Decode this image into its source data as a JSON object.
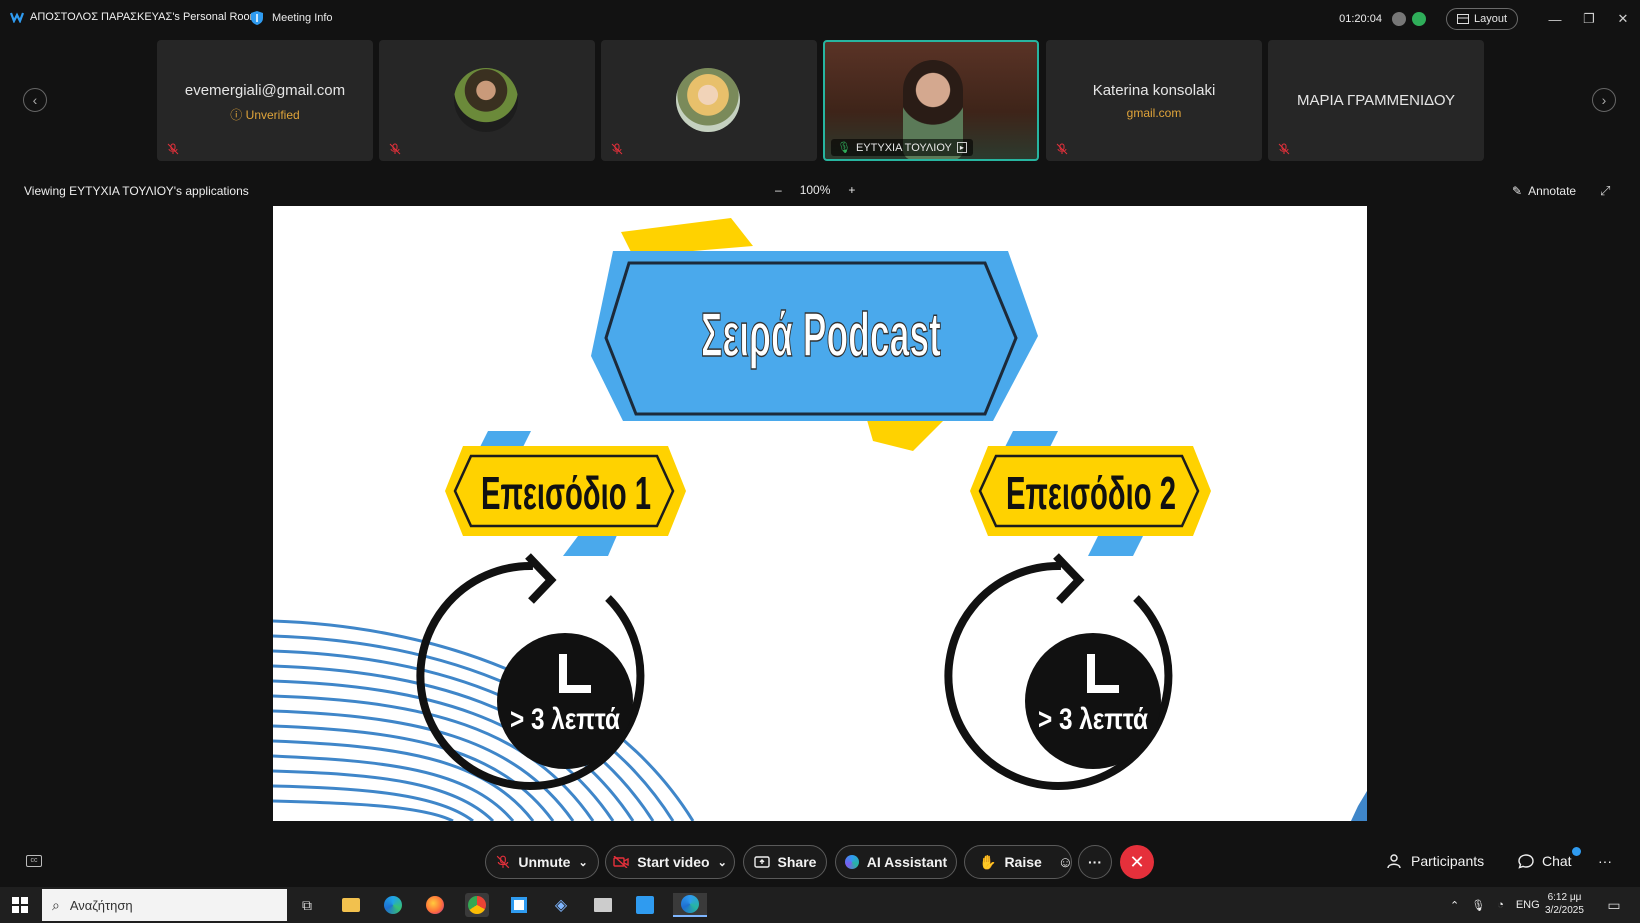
{
  "titlebar": {
    "room_name": "ΑΠΟΣΤΟΛΟΣ ΠΑΡΑΣΚΕΥΑΣ's Personal Room",
    "meeting_info": "Meeting Info",
    "timer": "01:20:04",
    "layout_label": "Layout"
  },
  "participants_strip": [
    {
      "name": "evemergiali@gmail.com",
      "sub": "Unverified"
    },
    {
      "name": "",
      "sub": ""
    },
    {
      "name": "",
      "sub": ""
    },
    {
      "name": "ΕΥΤΥΧΙΑ ΤΟΥΛΙΟΥ",
      "sub": ""
    },
    {
      "name": "Katerina konsolaki",
      "sub": "gmail.com"
    },
    {
      "name": "ΜΑΡΙΑ ΓΡΑΜΜΕΝΙΔΟΥ",
      "sub": ""
    }
  ],
  "share_bar": {
    "viewing": "Viewing ΕΥΤΥΧΙΑ ΤΟΥΛΙΟΥ's applications",
    "zoom_minus": "–",
    "zoom": "100%",
    "zoom_plus": "+",
    "annotate": "Annotate"
  },
  "slide": {
    "title": "Σειρά Podcast",
    "episode1": "Επεισόδιο 1",
    "episode2": "Επεισόδιο 2",
    "duration1": "> 3 λεπτά",
    "duration2": "> 3 λεπτά"
  },
  "controls": {
    "unmute": "Unmute",
    "start_video": "Start video",
    "share": "Share",
    "ai_assistant": "AI Assistant",
    "raise": "Raise",
    "more": "···",
    "participants": "Participants",
    "chat": "Chat",
    "overflow": "···"
  },
  "taskbar": {
    "search_placeholder": "Αναζήτηση",
    "lang": "ENG",
    "time": "6:12 μμ",
    "date": "3/2/2025"
  },
  "colors": {
    "accent_teal": "#27b5a0",
    "end_red": "#e5303b",
    "unverified_amber": "#e0a43a",
    "slide_blue": "#4aa9ec",
    "slide_yellow": "#ffd200"
  }
}
